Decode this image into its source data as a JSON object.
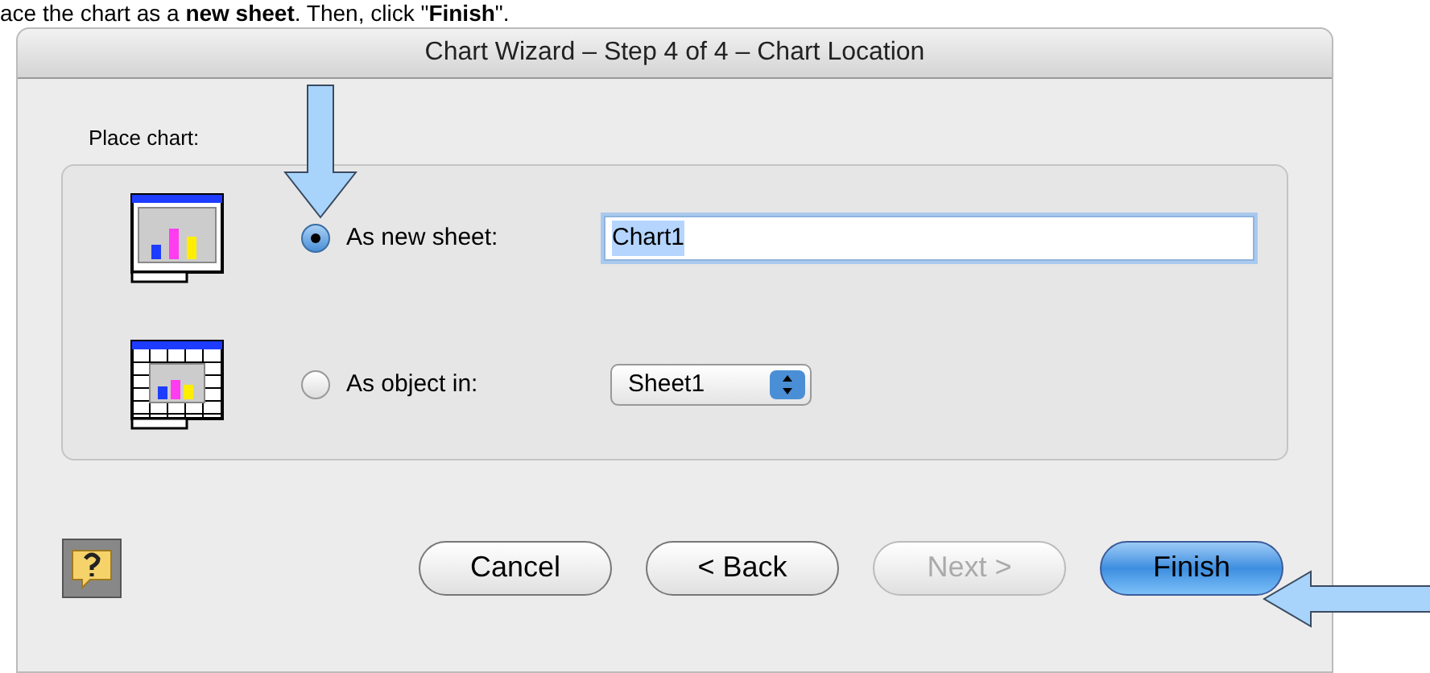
{
  "caption": "ace the chart as a **new sheet**. Then, click \"**Finish**\".",
  "window": {
    "title": "Chart Wizard – Step 4 of 4 – Chart Location"
  },
  "group": {
    "label": "Place chart:",
    "options": [
      {
        "label": "As new sheet:",
        "selected": true,
        "control": {
          "kind": "text",
          "value": "Chart1"
        }
      },
      {
        "label": "As object in:",
        "selected": false,
        "control": {
          "kind": "select",
          "value": "Sheet1"
        }
      }
    ]
  },
  "buttons": [
    {
      "label": "Cancel",
      "disabled": false,
      "default": false
    },
    {
      "label": "< Back",
      "disabled": false,
      "default": false
    },
    {
      "label": "Next >",
      "disabled": true,
      "default": false
    },
    {
      "label": "Finish",
      "disabled": false,
      "default": true
    }
  ]
}
